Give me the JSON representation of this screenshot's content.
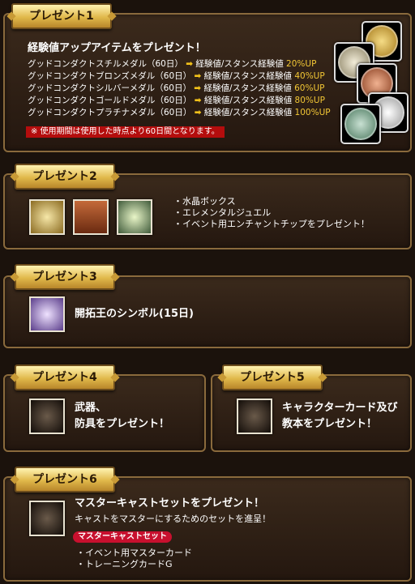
{
  "p1": {
    "tab": "プレゼント1",
    "heading": "経験値アップアイテムをプレゼント！",
    "rows": [
      {
        "item": "グッドコンダクトスチルメダル（60日）",
        "effect": "経験値/スタンス経験値",
        "value": "20%UP"
      },
      {
        "item": "グッドコンダクトブロンズメダル（60日）",
        "effect": "経験値/スタンス経験値",
        "value": "40%UP"
      },
      {
        "item": "グッドコンダクトシルバーメダル（60日）",
        "effect": "経験値/スタンス経験値",
        "value": "60%UP"
      },
      {
        "item": "グッドコンダクトゴールドメダル（60日）",
        "effect": "経験値/スタンス経験値",
        "value": "80%UP"
      },
      {
        "item": "グッドコンダクトプラチナメダル（60日）",
        "effect": "経験値/スタンス経験値",
        "value": "100%UP"
      }
    ],
    "arrow": "➡",
    "note": "※ 使用期間は使用した時点より60日間となります。",
    "medal_colors": [
      "#d8b24a",
      "#c9c0a5",
      "#c97a52",
      "#e0e0e0",
      "#7fa890"
    ]
  },
  "p2": {
    "tab": "プレゼント2",
    "items": [
      "・水晶ボックス",
      "・エレメンタルジュエル",
      "・イベント用エンチャントチップをプレゼント！"
    ]
  },
  "p3": {
    "tab": "プレゼント3",
    "label": "開拓王のシンボル(15日)"
  },
  "p4": {
    "tab": "プレゼント4",
    "line1": "武器、",
    "line2": "防具をプレゼント！"
  },
  "p5": {
    "tab": "プレゼント5",
    "line1": "キャラクターカード及び",
    "line2": "教本をプレゼント！"
  },
  "p6": {
    "tab": "プレゼント6",
    "title": "マスターキャストセットをプレゼント！",
    "subtitle": "キャストをマスターにするためのセットを進呈！",
    "badge": "マスターキャストセット",
    "items": [
      "・イベント用マスターカード",
      "・トレーニングカードG"
    ]
  }
}
